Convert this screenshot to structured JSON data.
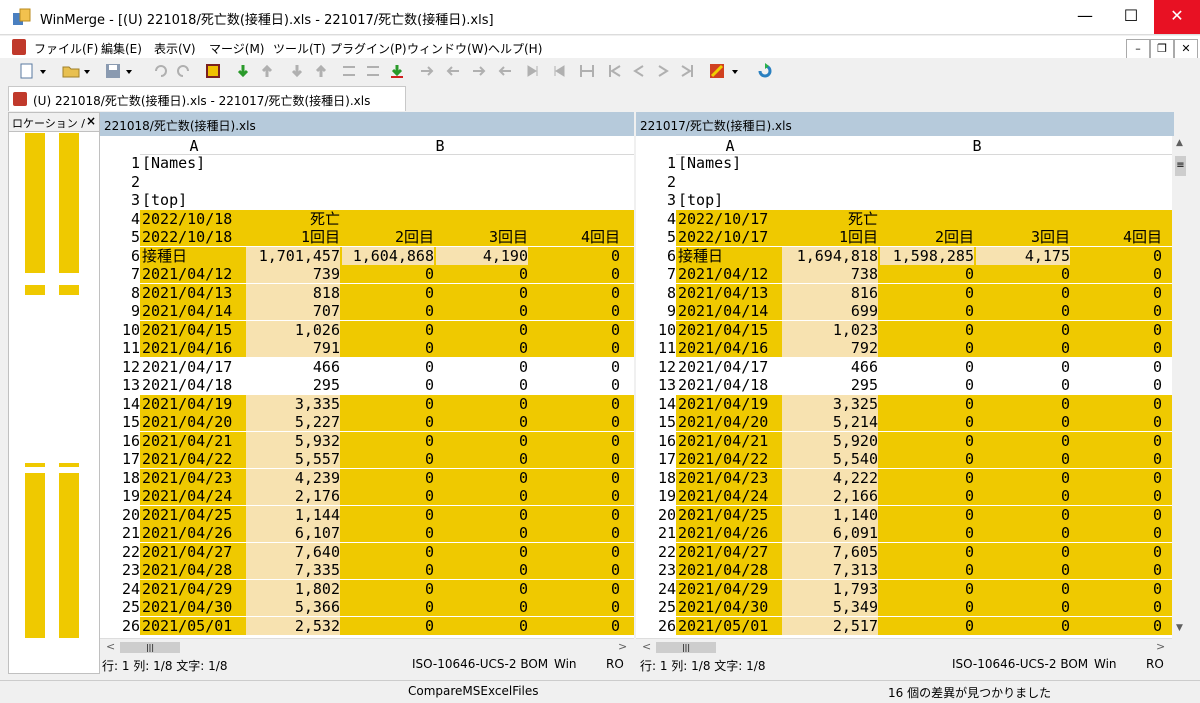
{
  "window": {
    "app_name": "WinMerge",
    "title": "WinMerge - [(U) 221018/死亡数(接種日).xls - 221017/死亡数(接種日).xls]",
    "minimize": "—",
    "maximize": "☐",
    "close": "✕"
  },
  "menu": [
    "ファイル(F)",
    "編集(E)",
    "表示(V)",
    "マージ(M)",
    "ツール(T)",
    "プラグイン(P)",
    "ウィンドウ(W)",
    "ヘルプ(H)"
  ],
  "mdi": {
    "minimize": "–",
    "restore": "❐",
    "close": "✕"
  },
  "tab": {
    "label": "(U) 221018/死亡数(接種日).xls - 221017/死亡数(接種日).xls"
  },
  "location_pane": {
    "title": "ロケーション /",
    "close": "×"
  },
  "columns": {
    "a": "A",
    "b": "B"
  },
  "left": {
    "header": "221018/死亡数(接種日).xls",
    "status": {
      "pos": "行: 1 列: 1/8 文字: 1/8",
      "encoding": "ISO-10646-UCS-2 BOM",
      "eol": "Win",
      "mode": "RO"
    },
    "rows": [
      {
        "n": "1",
        "a": "[Names]",
        "b1": "",
        "b2": "",
        "b3": "",
        "b4": "",
        "diff": false
      },
      {
        "n": "2",
        "a": "",
        "b1": "",
        "b2": "",
        "b3": "",
        "b4": "",
        "diff": false
      },
      {
        "n": "3",
        "a": "[top]",
        "b1": "",
        "b2": "",
        "b3": "",
        "b4": "",
        "diff": false
      },
      {
        "n": "4",
        "a": "2022/10/18",
        "b1": "死亡",
        "b2": "",
        "b3": "",
        "b4": "",
        "diff": true
      },
      {
        "n": "5",
        "a": "2022/10/18",
        "b1": "1回目",
        "b2": "2回目",
        "b3": "3回目",
        "b4": "4回目",
        "diff": true
      },
      {
        "n": "6",
        "a": "接種日",
        "b1": "1,701,457",
        "b2": "1,604,868",
        "b3": "4,190",
        "b4": "0",
        "diff": true
      },
      {
        "n": "7",
        "a": "2021/04/12",
        "b1": "739",
        "b2": "0",
        "b3": "0",
        "b4": "0",
        "diff": true
      },
      {
        "n": "8",
        "a": "2021/04/13",
        "b1": "818",
        "b2": "0",
        "b3": "0",
        "b4": "0",
        "diff": true
      },
      {
        "n": "9",
        "a": "2021/04/14",
        "b1": "707",
        "b2": "0",
        "b3": "0",
        "b4": "0",
        "diff": true
      },
      {
        "n": "10",
        "a": "2021/04/15",
        "b1": "1,026",
        "b2": "0",
        "b3": "0",
        "b4": "0",
        "diff": true
      },
      {
        "n": "11",
        "a": "2021/04/16",
        "b1": "791",
        "b2": "0",
        "b3": "0",
        "b4": "0",
        "diff": true
      },
      {
        "n": "12",
        "a": "2021/04/17",
        "b1": "466",
        "b2": "0",
        "b3": "0",
        "b4": "0",
        "diff": false
      },
      {
        "n": "13",
        "a": "2021/04/18",
        "b1": "295",
        "b2": "0",
        "b3": "0",
        "b4": "0",
        "diff": false
      },
      {
        "n": "14",
        "a": "2021/04/19",
        "b1": "3,335",
        "b2": "0",
        "b3": "0",
        "b4": "0",
        "diff": true
      },
      {
        "n": "15",
        "a": "2021/04/20",
        "b1": "5,227",
        "b2": "0",
        "b3": "0",
        "b4": "0",
        "diff": true
      },
      {
        "n": "16",
        "a": "2021/04/21",
        "b1": "5,932",
        "b2": "0",
        "b3": "0",
        "b4": "0",
        "diff": true
      },
      {
        "n": "17",
        "a": "2021/04/22",
        "b1": "5,557",
        "b2": "0",
        "b3": "0",
        "b4": "0",
        "diff": true
      },
      {
        "n": "18",
        "a": "2021/04/23",
        "b1": "4,239",
        "b2": "0",
        "b3": "0",
        "b4": "0",
        "diff": true
      },
      {
        "n": "19",
        "a": "2021/04/24",
        "b1": "2,176",
        "b2": "0",
        "b3": "0",
        "b4": "0",
        "diff": true
      },
      {
        "n": "20",
        "a": "2021/04/25",
        "b1": "1,144",
        "b2": "0",
        "b3": "0",
        "b4": "0",
        "diff": true
      },
      {
        "n": "21",
        "a": "2021/04/26",
        "b1": "6,107",
        "b2": "0",
        "b3": "0",
        "b4": "0",
        "diff": true
      },
      {
        "n": "22",
        "a": "2021/04/27",
        "b1": "7,640",
        "b2": "0",
        "b3": "0",
        "b4": "0",
        "diff": true
      },
      {
        "n": "23",
        "a": "2021/04/28",
        "b1": "7,335",
        "b2": "0",
        "b3": "0",
        "b4": "0",
        "diff": true
      },
      {
        "n": "24",
        "a": "2021/04/29",
        "b1": "1,802",
        "b2": "0",
        "b3": "0",
        "b4": "0",
        "diff": true
      },
      {
        "n": "25",
        "a": "2021/04/30",
        "b1": "5,366",
        "b2": "0",
        "b3": "0",
        "b4": "0",
        "diff": true
      },
      {
        "n": "26",
        "a": "2021/05/01",
        "b1": "2,532",
        "b2": "0",
        "b3": "0",
        "b4": "0",
        "diff": true
      }
    ]
  },
  "right": {
    "header": "221017/死亡数(接種日).xls",
    "status": {
      "pos": "行: 1 列: 1/8 文字: 1/8",
      "encoding": "ISO-10646-UCS-2 BOM",
      "eol": "Win",
      "mode": "RO"
    },
    "rows": [
      {
        "n": "1",
        "a": "[Names]",
        "b1": "",
        "b2": "",
        "b3": "",
        "b4": "",
        "diff": false
      },
      {
        "n": "2",
        "a": "",
        "b1": "",
        "b2": "",
        "b3": "",
        "b4": "",
        "diff": false
      },
      {
        "n": "3",
        "a": "[top]",
        "b1": "",
        "b2": "",
        "b3": "",
        "b4": "",
        "diff": false
      },
      {
        "n": "4",
        "a": "2022/10/17",
        "b1": "死亡",
        "b2": "",
        "b3": "",
        "b4": "",
        "diff": true
      },
      {
        "n": "5",
        "a": "2022/10/17",
        "b1": "1回目",
        "b2": "2回目",
        "b3": "3回目",
        "b4": "4回目",
        "diff": true
      },
      {
        "n": "6",
        "a": "接種日",
        "b1": "1,694,818",
        "b2": "1,598,285",
        "b3": "4,175",
        "b4": "0",
        "diff": true
      },
      {
        "n": "7",
        "a": "2021/04/12",
        "b1": "738",
        "b2": "0",
        "b3": "0",
        "b4": "0",
        "diff": true
      },
      {
        "n": "8",
        "a": "2021/04/13",
        "b1": "816",
        "b2": "0",
        "b3": "0",
        "b4": "0",
        "diff": true
      },
      {
        "n": "9",
        "a": "2021/04/14",
        "b1": "699",
        "b2": "0",
        "b3": "0",
        "b4": "0",
        "diff": true
      },
      {
        "n": "10",
        "a": "2021/04/15",
        "b1": "1,023",
        "b2": "0",
        "b3": "0",
        "b4": "0",
        "diff": true
      },
      {
        "n": "11",
        "a": "2021/04/16",
        "b1": "792",
        "b2": "0",
        "b3": "0",
        "b4": "0",
        "diff": true
      },
      {
        "n": "12",
        "a": "2021/04/17",
        "b1": "466",
        "b2": "0",
        "b3": "0",
        "b4": "0",
        "diff": false
      },
      {
        "n": "13",
        "a": "2021/04/18",
        "b1": "295",
        "b2": "0",
        "b3": "0",
        "b4": "0",
        "diff": false
      },
      {
        "n": "14",
        "a": "2021/04/19",
        "b1": "3,325",
        "b2": "0",
        "b3": "0",
        "b4": "0",
        "diff": true
      },
      {
        "n": "15",
        "a": "2021/04/20",
        "b1": "5,214",
        "b2": "0",
        "b3": "0",
        "b4": "0",
        "diff": true
      },
      {
        "n": "16",
        "a": "2021/04/21",
        "b1": "5,920",
        "b2": "0",
        "b3": "0",
        "b4": "0",
        "diff": true
      },
      {
        "n": "17",
        "a": "2021/04/22",
        "b1": "5,540",
        "b2": "0",
        "b3": "0",
        "b4": "0",
        "diff": true
      },
      {
        "n": "18",
        "a": "2021/04/23",
        "b1": "4,222",
        "b2": "0",
        "b3": "0",
        "b4": "0",
        "diff": true
      },
      {
        "n": "19",
        "a": "2021/04/24",
        "b1": "2,166",
        "b2": "0",
        "b3": "0",
        "b4": "0",
        "diff": true
      },
      {
        "n": "20",
        "a": "2021/04/25",
        "b1": "1,140",
        "b2": "0",
        "b3": "0",
        "b4": "0",
        "diff": true
      },
      {
        "n": "21",
        "a": "2021/04/26",
        "b1": "6,091",
        "b2": "0",
        "b3": "0",
        "b4": "0",
        "diff": true
      },
      {
        "n": "22",
        "a": "2021/04/27",
        "b1": "7,605",
        "b2": "0",
        "b3": "0",
        "b4": "0",
        "diff": true
      },
      {
        "n": "23",
        "a": "2021/04/28",
        "b1": "7,313",
        "b2": "0",
        "b3": "0",
        "b4": "0",
        "diff": true
      },
      {
        "n": "24",
        "a": "2021/04/29",
        "b1": "1,793",
        "b2": "0",
        "b3": "0",
        "b4": "0",
        "diff": true
      },
      {
        "n": "25",
        "a": "2021/04/30",
        "b1": "5,349",
        "b2": "0",
        "b3": "0",
        "b4": "0",
        "diff": true
      },
      {
        "n": "26",
        "a": "2021/05/01",
        "b1": "2,517",
        "b2": "0",
        "b3": "0",
        "b4": "0",
        "diff": true
      }
    ]
  },
  "scroll": {
    "left": "<",
    "right": ">",
    "thumb": "|||",
    "vthumb": "≡"
  },
  "statusbar": {
    "plugin": "CompareMSExcelFiles",
    "message": "16 個の差異が見つかりました"
  },
  "colors": {
    "diff": "#efc900",
    "inline_diff": "#f7e2b0",
    "pane_header": "#b6cadb",
    "close": "#e81123"
  }
}
